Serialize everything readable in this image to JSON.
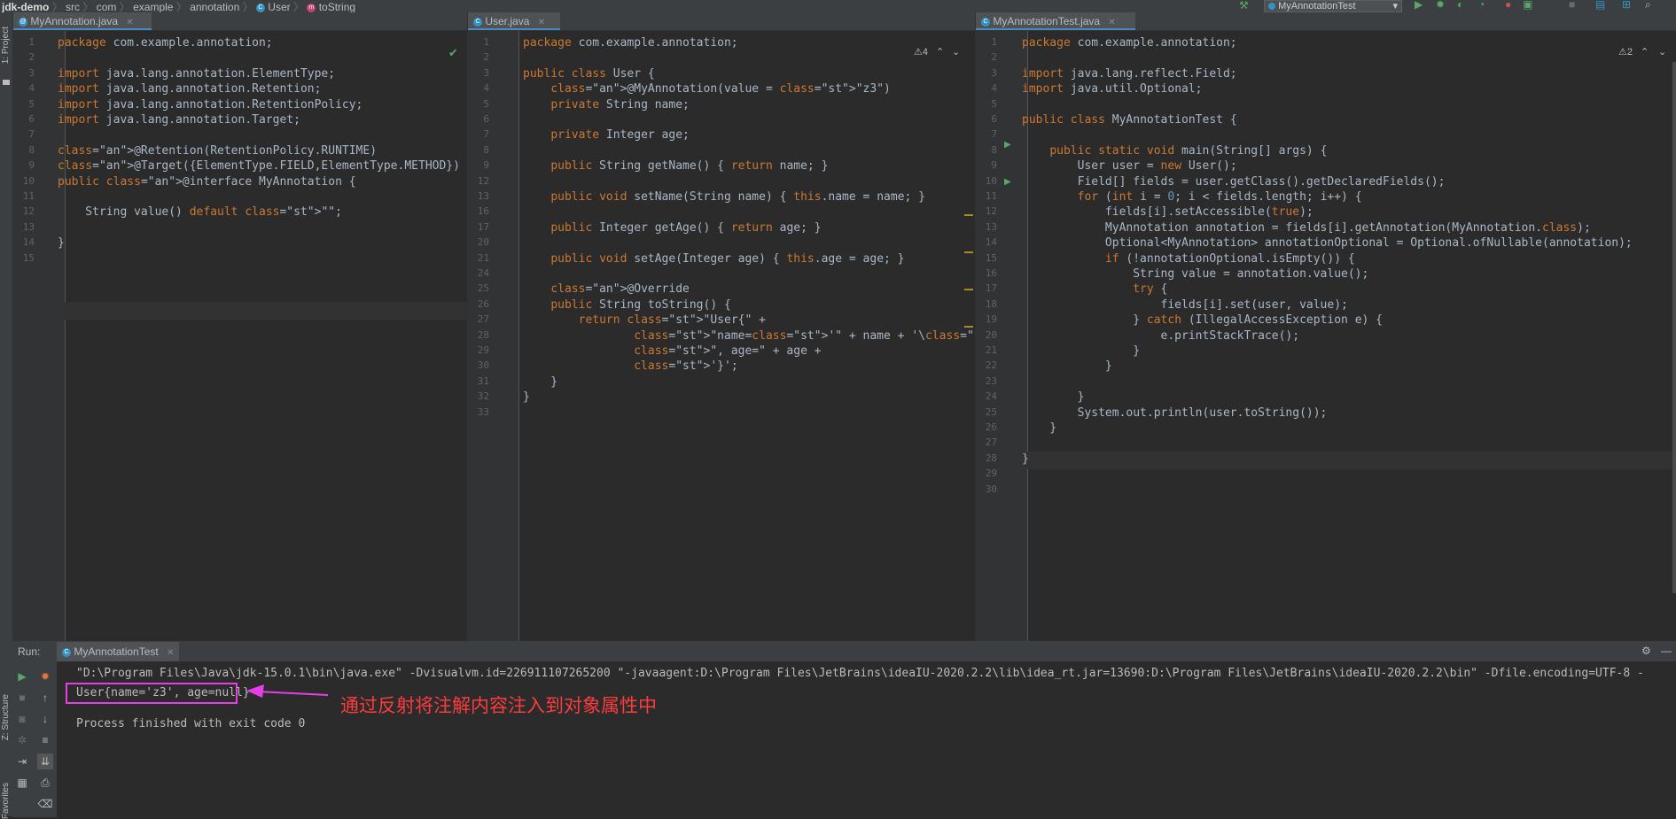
{
  "breadcrumb": [
    "jdk-demo",
    "src",
    "com",
    "example",
    "annotation",
    "User",
    "toString"
  ],
  "run_config": "MyAnnotationTest",
  "side_labels": {
    "project": "1: Project",
    "structure": "Z: Structure",
    "favorites": "Favorites"
  },
  "tabs": {
    "left": "MyAnnotation.java",
    "middle": "User.java",
    "right": "MyAnnotationTest.java"
  },
  "warnings": {
    "middle": "⚠4",
    "right": "⚠2"
  },
  "colors": {
    "accent": "#4a88c7",
    "highlight_box": "#e83ee8",
    "annotation_text": "#ff3b3b"
  },
  "left_code": [
    {
      "n": "1",
      "t": "package com.example.annotation;"
    },
    {
      "n": "2",
      "t": ""
    },
    {
      "n": "3",
      "t": "import java.lang.annotation.ElementType;"
    },
    {
      "n": "4",
      "t": "import java.lang.annotation.Retention;"
    },
    {
      "n": "5",
      "t": "import java.lang.annotation.RetentionPolicy;"
    },
    {
      "n": "6",
      "t": "import java.lang.annotation.Target;"
    },
    {
      "n": "7",
      "t": ""
    },
    {
      "n": "8",
      "t": "@Retention(RetentionPolicy.RUNTIME)"
    },
    {
      "n": "9",
      "t": "@Target({ElementType.FIELD,ElementType.METHOD})"
    },
    {
      "n": "10",
      "t": "public @interface MyAnnotation {"
    },
    {
      "n": "11",
      "t": ""
    },
    {
      "n": "12",
      "t": "    String value() default \"\";"
    },
    {
      "n": "13",
      "t": ""
    },
    {
      "n": "14",
      "t": "}"
    },
    {
      "n": "15",
      "t": ""
    }
  ],
  "middle_code": [
    {
      "n": "1",
      "t": "package com.example.annotation;"
    },
    {
      "n": "2",
      "t": ""
    },
    {
      "n": "3",
      "t": "public class User {"
    },
    {
      "n": "4",
      "t": "    @MyAnnotation(value = \"z3\")"
    },
    {
      "n": "5",
      "t": "    private String name;"
    },
    {
      "n": "6",
      "t": ""
    },
    {
      "n": "7",
      "t": "    private Integer age;"
    },
    {
      "n": "8",
      "t": ""
    },
    {
      "n": "9",
      "t": "    public String getName() { return name; }"
    },
    {
      "n": "12",
      "t": ""
    },
    {
      "n": "13",
      "t": "    public void setName(String name) { this.name = name; }"
    },
    {
      "n": "16",
      "t": ""
    },
    {
      "n": "17",
      "t": "    public Integer getAge() { return age; }"
    },
    {
      "n": "20",
      "t": ""
    },
    {
      "n": "21",
      "t": "    public void setAge(Integer age) { this.age = age; }"
    },
    {
      "n": "24",
      "t": ""
    },
    {
      "n": "25",
      "t": "    @Override"
    },
    {
      "n": "26",
      "t": "    public String toString() {"
    },
    {
      "n": "27",
      "t": "        return \"User{\" +"
    },
    {
      "n": "28",
      "t": "                \"name='\" + name + '\\'' +"
    },
    {
      "n": "29",
      "t": "                \", age=\" + age +"
    },
    {
      "n": "30",
      "t": "                '}';"
    },
    {
      "n": "31",
      "t": "    }"
    },
    {
      "n": "32",
      "t": "}"
    },
    {
      "n": "33",
      "t": ""
    }
  ],
  "right_code": [
    {
      "n": "1",
      "t": "package com.example.annotation;"
    },
    {
      "n": "2",
      "t": ""
    },
    {
      "n": "3",
      "t": "import java.lang.reflect.Field;"
    },
    {
      "n": "4",
      "t": "import java.util.Optional;"
    },
    {
      "n": "5",
      "t": ""
    },
    {
      "n": "6",
      "t": "public class MyAnnotationTest {"
    },
    {
      "n": "7",
      "t": ""
    },
    {
      "n": "8",
      "t": "    public static void main(String[] args) {"
    },
    {
      "n": "9",
      "t": "        User user = new User();"
    },
    {
      "n": "10",
      "t": "        Field[] fields = user.getClass().getDeclaredFields();"
    },
    {
      "n": "11",
      "t": "        for (int i = 0; i < fields.length; i++) {"
    },
    {
      "n": "12",
      "t": "            fields[i].setAccessible(true);"
    },
    {
      "n": "13",
      "t": "            MyAnnotation annotation = fields[i].getAnnotation(MyAnnotation.class);"
    },
    {
      "n": "14",
      "t": "            Optional<MyAnnotation> annotationOptional = Optional.ofNullable(annotation);"
    },
    {
      "n": "15",
      "t": "            if (!annotationOptional.isEmpty()) {"
    },
    {
      "n": "16",
      "t": "                String value = annotation.value();"
    },
    {
      "n": "17",
      "t": "                try {"
    },
    {
      "n": "18",
      "t": "                    fields[i].set(user, value);"
    },
    {
      "n": "19",
      "t": "                } catch (IllegalAccessException e) {"
    },
    {
      "n": "20",
      "t": "                    e.printStackTrace();"
    },
    {
      "n": "21",
      "t": "                }"
    },
    {
      "n": "22",
      "t": "            }"
    },
    {
      "n": "23",
      "t": ""
    },
    {
      "n": "24",
      "t": "        }"
    },
    {
      "n": "25",
      "t": "        System.out.println(user.toString());"
    },
    {
      "n": "26",
      "t": "    }"
    },
    {
      "n": "27",
      "t": ""
    },
    {
      "n": "28",
      "t": "}"
    },
    {
      "n": "29",
      "t": ""
    },
    {
      "n": "30",
      "t": ""
    }
  ],
  "run_panel": {
    "label": "Run:",
    "tab": "MyAnnotationTest",
    "command": "\"D:\\Program Files\\Java\\jdk-15.0.1\\bin\\java.exe\" -Dvisualvm.id=226911107265200 \"-javaagent:D:\\Program Files\\JetBrains\\ideaIU-2020.2.2\\lib\\idea_rt.jar=13690:D:\\Program Files\\JetBrains\\ideaIU-2020.2.2\\bin\" -Dfile.encoding=UTF-8 -",
    "output": "User{name='z3', age=null}",
    "finished": "Process finished with exit code 0",
    "annotation": "通过反射将注解内容注入到对象属性中"
  }
}
